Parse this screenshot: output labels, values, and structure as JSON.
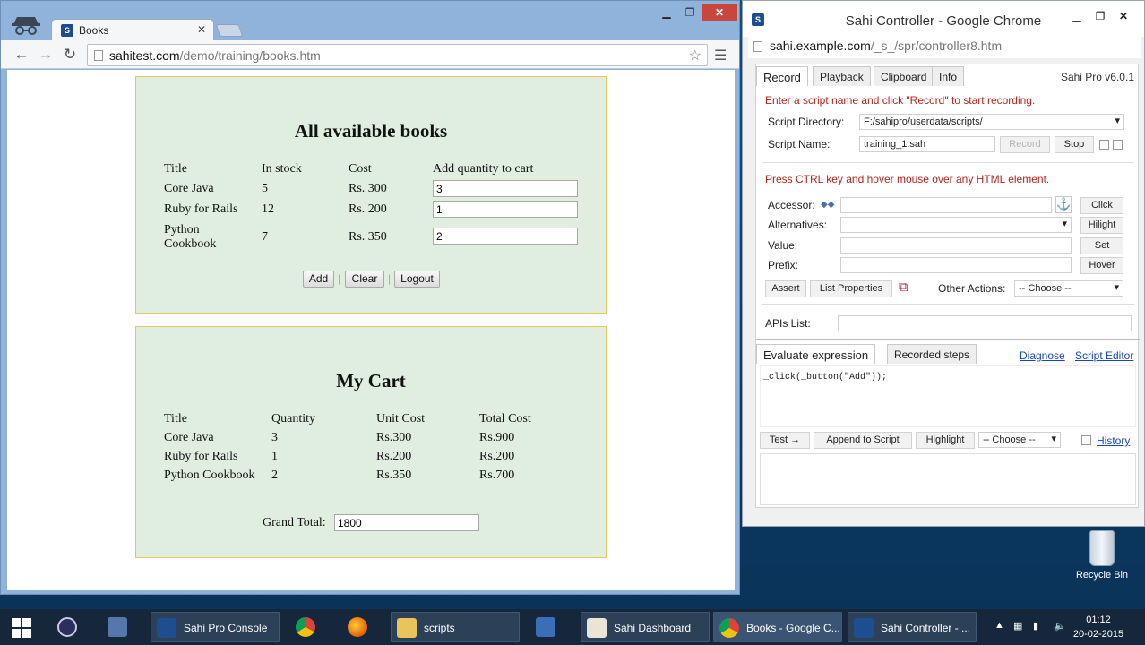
{
  "browser": {
    "tab_title": "Books",
    "url_host": "sahitest.com",
    "url_path": "/demo/training/books.htm"
  },
  "books": {
    "heading": "All available books",
    "headers": [
      "Title",
      "In stock",
      "Cost",
      "Add quantity to cart"
    ],
    "rows": [
      {
        "title": "Core Java",
        "stock": "5",
        "cost": "Rs. 300",
        "qty": "3"
      },
      {
        "title": "Ruby for Rails",
        "stock": "12",
        "cost": "Rs. 200",
        "qty": "1"
      },
      {
        "title": "Python Cookbook",
        "stock": "7",
        "cost": "Rs. 350",
        "qty": "2"
      }
    ],
    "buttons": {
      "add": "Add",
      "clear": "Clear",
      "logout": "Logout"
    }
  },
  "cart": {
    "heading": "My Cart",
    "headers": [
      "Title",
      "Quantity",
      "Unit Cost",
      "Total Cost"
    ],
    "rows": [
      {
        "title": "Core Java",
        "qty": "3",
        "unit": "Rs.300",
        "total": "Rs.900"
      },
      {
        "title": "Ruby for Rails",
        "qty": "1",
        "unit": "Rs.200",
        "total": "Rs.200"
      },
      {
        "title": "Python Cookbook",
        "qty": "2",
        "unit": "Rs.350",
        "total": "Rs.700"
      }
    ],
    "grand_total_label": "Grand Total:",
    "grand_total_value": "1800"
  },
  "sahi": {
    "window_title": "Sahi Controller - Google Chrome",
    "url_host": "sahi.example.com",
    "url_path": "/_s_/spr/controller8.htm",
    "tabs": [
      "Record",
      "Playback",
      "Clipboard",
      "Info"
    ],
    "version": "Sahi Pro v6.0.1",
    "record_hint": "Enter a script name and click \"Record\" to start recording.",
    "script_dir_label": "Script Directory:",
    "script_dir_value": "F:/sahipro/userdata/scripts/",
    "script_name_label": "Script Name:",
    "script_name_value": "training_1.sah",
    "record_btn": "Record",
    "stop_btn": "Stop",
    "hover_hint": "Press CTRL key and hover mouse over any HTML element.",
    "accessor_label": "Accessor:",
    "alternatives_label": "Alternatives:",
    "value_label": "Value:",
    "prefix_label": "Prefix:",
    "click_btn": "Click",
    "hilight_btn": "Hilight",
    "set_btn": "Set",
    "hover_btn": "Hover",
    "assert_btn": "Assert",
    "list_props_btn": "List Properties",
    "other_actions_label": "Other Actions:",
    "choose": "-- Choose --",
    "apis_label": "APIs List:",
    "eval_tab": "Evaluate expression",
    "recorded_tab": "Recorded steps",
    "diagnose": "Diagnose",
    "script_editor": "Script Editor",
    "code": "_click(_button(\"Add\"));",
    "test_btn": "Test →",
    "append_btn": "Append to Script",
    "highlight_btn": "Highlight",
    "history": "History"
  },
  "desktop": {
    "recycle_bin": "Recycle Bin"
  },
  "taskbar": {
    "items": [
      "Sahi Pro Console",
      "scripts",
      "Sahi Dashboard",
      "Books - Google C...",
      "Sahi Controller - ..."
    ],
    "time": "01:12",
    "date": "20-02-2015"
  }
}
